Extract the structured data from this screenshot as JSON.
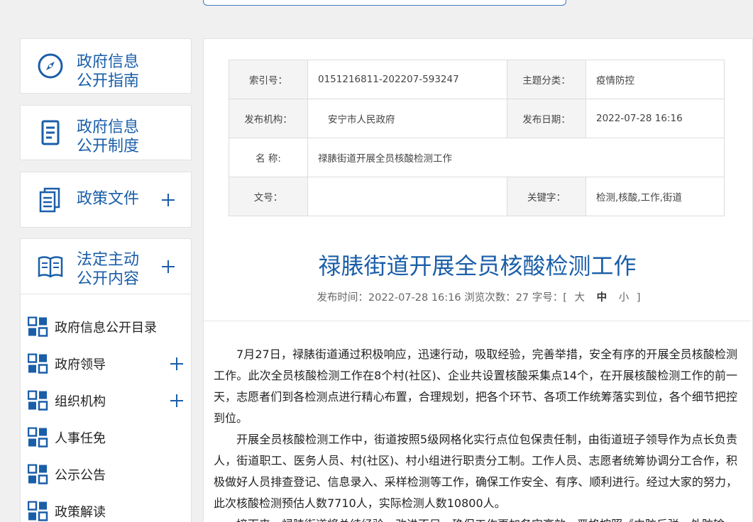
{
  "sidebar": {
    "cards": [
      {
        "label": "政府信息\n公开指南",
        "icon": "compass-icon"
      },
      {
        "label": "政府信息\n公开制度",
        "icon": "document-icon"
      },
      {
        "label": "政策文件",
        "icon": "files-icon"
      },
      {
        "label": "法定主动\n公开内容",
        "icon": "book-icon"
      }
    ],
    "subitems": [
      {
        "label": "政府信息公开目录"
      },
      {
        "label": "政府领导"
      },
      {
        "label": "组织机构"
      },
      {
        "label": "人事任免"
      },
      {
        "label": "公示公告"
      },
      {
        "label": "政策解读"
      }
    ]
  },
  "meta": {
    "index_label": "索引号：",
    "index_value": "0151216811-202207-593247",
    "category_label": "主题分类：",
    "category_value": "疫情防控",
    "publisher_label": "发布机构：",
    "publisher_value": "安宁市人民政府",
    "date_label": "发布日期：",
    "date_value": "2022-07-28 16:16",
    "name_label": "名  称:",
    "name_value": "禄脿街道开展全员核酸检测工作",
    "docno_label": "文号：",
    "docno_value": "",
    "keywords_label": "关键字：",
    "keywords_value": "检测,核酸,工作,街道"
  },
  "article": {
    "title": "禄脿街道开展全员核酸检测工作",
    "pubinfo": "发布时间：2022-07-28 16:16 浏览次数：27 字号：[",
    "font_large": "大",
    "font_medium": "中",
    "font_small": "小",
    "font_close": "]",
    "paragraphs": [
      "7月27日，禄脿街道通过积极响应，迅速行动，吸取经验，完善举措，安全有序的开展全员核酸检测工作。此次全员核酸检测工作在8个村(社区)、企业共设置核酸采集点14个，在开展核酸检测工作的前一天，志愿者们到各检测点进行精心布置，合理规划，把各个环节、各项工作统筹落实到位，各个细节把控到位。",
      "开展全员核酸检测工作中，街道按照5级网格化实行点位包保责任制，由街道班子领导作为点长负责人，街道职工、医务人员、村(社区)、村小组进行职责分工制。工作人员、志愿者统筹协调分工合作，积极做好人员排查登记、信息录入、采样检测等工作，确保工作安全、有序、顺利进行。经过大家的努力，此次核酸检测预估人数7710人，实际检测人数10800人。",
      "接下来，禄脿街道将总结经验，改进不足，确保工作更加务实高效，严格按照《内防反弹、外防输"
    ]
  }
}
